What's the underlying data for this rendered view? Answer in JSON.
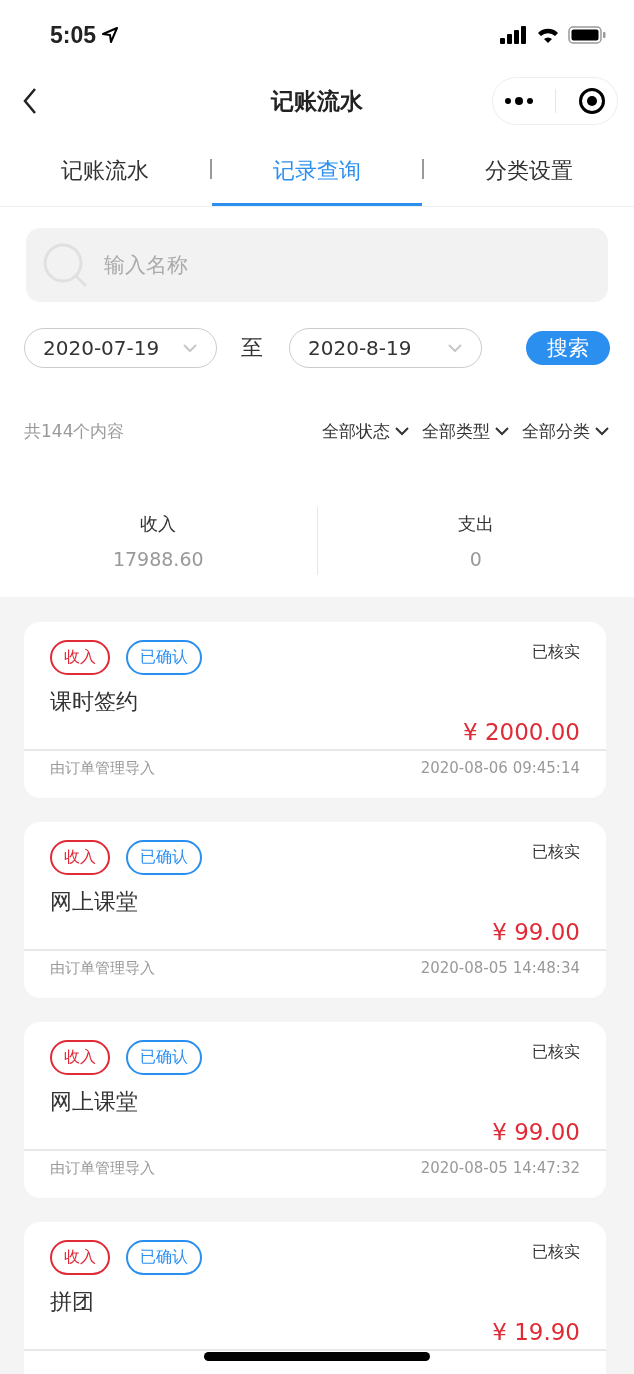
{
  "status_bar": {
    "time": "5:05"
  },
  "nav": {
    "title": "记账流水"
  },
  "tabs": [
    {
      "label": "记账流水",
      "selected": false
    },
    {
      "label": "记录查询",
      "selected": true
    },
    {
      "label": "分类设置",
      "selected": false
    }
  ],
  "search": {
    "placeholder": "输入名称"
  },
  "date_range": {
    "start": "2020-07-19",
    "separator": "至",
    "end": "2020-8-19",
    "button": "搜索"
  },
  "filters": {
    "count": "共144个内容",
    "dropdowns": [
      "全部状态",
      "全部类型",
      "全部分类"
    ]
  },
  "summary": [
    {
      "label": "收入",
      "value": "17988.60"
    },
    {
      "label": "支出",
      "value": "0"
    }
  ],
  "records": [
    {
      "tags": [
        {
          "label": "收入",
          "kind": "income"
        },
        {
          "label": "已确认",
          "kind": "confirmed"
        }
      ],
      "status": "已核实",
      "title": "课时签约",
      "amount": "¥ 2000.00",
      "source": "由订单管理导入",
      "time": "2020-08-06 09:45:14"
    },
    {
      "tags": [
        {
          "label": "收入",
          "kind": "income"
        },
        {
          "label": "已确认",
          "kind": "confirmed"
        }
      ],
      "status": "已核实",
      "title": "网上课堂",
      "amount": "¥ 99.00",
      "source": "由订单管理导入",
      "time": "2020-08-05 14:48:34"
    },
    {
      "tags": [
        {
          "label": "收入",
          "kind": "income"
        },
        {
          "label": "已确认",
          "kind": "confirmed"
        }
      ],
      "status": "已核实",
      "title": "网上课堂",
      "amount": "¥ 99.00",
      "source": "由订单管理导入",
      "time": "2020-08-05 14:47:32"
    },
    {
      "tags": [
        {
          "label": "收入",
          "kind": "income"
        },
        {
          "label": "已确认",
          "kind": "confirmed"
        }
      ],
      "status": "已核实",
      "title": "拼团",
      "amount": "¥ 19.90"
    }
  ]
}
